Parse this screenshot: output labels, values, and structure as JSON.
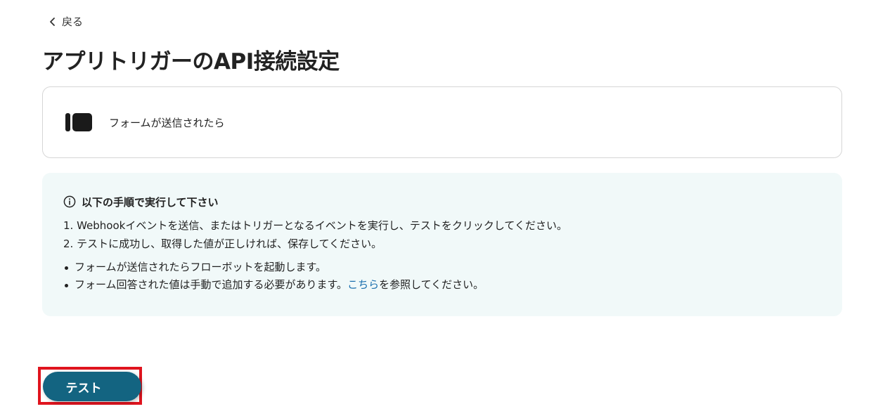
{
  "nav": {
    "back_label": "戻る"
  },
  "page": {
    "title": "アプリトリガーのAPI接続設定"
  },
  "trigger": {
    "label": "フォームが送信されたら",
    "icon": "app-logo"
  },
  "info": {
    "heading": "以下の手順で実行して下さい",
    "steps": [
      "1. Webhookイベントを送信、またはトリガーとなるイベントを実行し、テストをクリックしてください。",
      "2. テストに成功し、取得した値が正しければ、保存してください。"
    ],
    "notes": [
      {
        "text": "フォームが送信されたらフローボットを起動します。"
      },
      {
        "before": "フォーム回答された値は手動で追加する必要があります。",
        "link": "こちら",
        "after": "を参照してください。"
      }
    ]
  },
  "actions": {
    "test_label": "テスト"
  },
  "colors": {
    "button_bg": "#136481",
    "info_bg": "#f1f9f9",
    "highlight": "#e0141e",
    "link": "#1a6fae"
  }
}
